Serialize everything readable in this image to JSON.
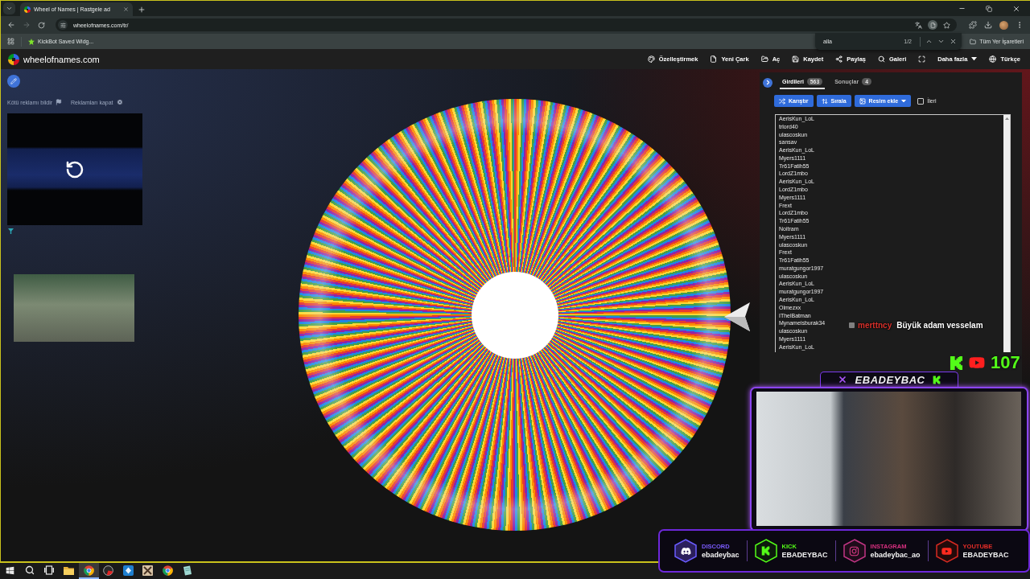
{
  "browser": {
    "tab_title": "Wheel of Names | Rastgele ad",
    "url": "wheelofnames.com/tr/",
    "bookmarks": [
      {
        "label": "KickBot Saved Widg..."
      }
    ],
    "all_bookmarks": "Tüm Yer İşaretleri",
    "find_bar": {
      "value": "alla",
      "count": "1/2"
    }
  },
  "site": {
    "logo_text": "wheelofnames.com",
    "nav": [
      {
        "kind": "palette",
        "label": "Özelleştirmek"
      },
      {
        "kind": "file",
        "label": "Yeni Çark"
      },
      {
        "kind": "folder",
        "label": "Aç"
      },
      {
        "kind": "save",
        "label": "Kaydet"
      },
      {
        "kind": "share",
        "label": "Paylaş"
      },
      {
        "kind": "search",
        "label": "Galeri"
      },
      {
        "kind": "fullscreen"
      },
      {
        "kind": "more",
        "label": "Daha fazla"
      },
      {
        "kind": "language",
        "label": "Türkçe"
      }
    ]
  },
  "ads": {
    "report_link": "Kötü reklamı bildir",
    "close_link": "Reklamları kapat"
  },
  "panel": {
    "tabs": [
      {
        "label": "Girdileri",
        "count": "563",
        "selected": true
      },
      {
        "label": "Sonuçlar",
        "count": "4",
        "selected": false
      }
    ],
    "buttons": [
      {
        "kind": "shuffle",
        "label": "Karıştır"
      },
      {
        "kind": "sort",
        "label": "Sırala"
      },
      {
        "kind": "image",
        "label": "Resim ekle"
      }
    ],
    "advanced": {
      "label": "İleri",
      "checked": false
    },
    "entries": [
      "AerisKun_LoL",
      "trlord40",
      "ulascoskun",
      "sansav",
      "AerisKun_LoL",
      "Myers1111",
      "Tr61Fatih55",
      "LordZ1mbo",
      "AerisKun_LoL",
      "LordZ1mbo",
      "Myers1111",
      "Frext",
      "LordZ1mbo",
      "Tr61Fatih55",
      "Noitram",
      "Myers1111",
      "ulascoskun",
      "Frext",
      "Tr61Fatih55",
      "muratgungor1997",
      "ulascoskun",
      "AerisKun_LoL",
      "muratgungor1997",
      "AerisKun_LoL",
      "Olmezxx",
      "IThelBatman",
      "Mynameisburak34",
      "ulascoskun",
      "Myers1111",
      "AerisKun_LoL"
    ]
  },
  "stream": {
    "chat": {
      "user": "merttncy",
      "message": "Büyük adam vesselam"
    },
    "viewer_count": "107",
    "webcam_title": "EBADEYBAC",
    "socials": [
      {
        "kind": "discord",
        "platform": "DISCORD",
        "handle": "ebadeybac",
        "color": "#7c5cff"
      },
      {
        "kind": "kick",
        "platform": "KICK",
        "handle": "EBADEYBAC",
        "color": "#53fc18"
      },
      {
        "kind": "instagram",
        "platform": "INSTAGRAM",
        "handle": "ebadeybac_ao",
        "color": "#d6307f"
      },
      {
        "kind": "youtube",
        "platform": "YOUTUBE",
        "handle": "EBADEYBAC",
        "color": "#e52d27"
      }
    ]
  },
  "taskbar": {
    "apps": [
      {
        "kind": "windows",
        "active": false
      },
      {
        "kind": "search",
        "active": false
      },
      {
        "kind": "task-view",
        "active": false
      },
      {
        "kind": "folder",
        "active": false
      },
      {
        "kind": "browser",
        "active": true
      },
      {
        "kind": "gauge",
        "active": false
      },
      {
        "kind": "blue-app",
        "active": false
      },
      {
        "kind": "game",
        "active": false
      },
      {
        "kind": "browser",
        "active": false
      },
      {
        "kind": "notes",
        "active": false
      }
    ]
  }
}
